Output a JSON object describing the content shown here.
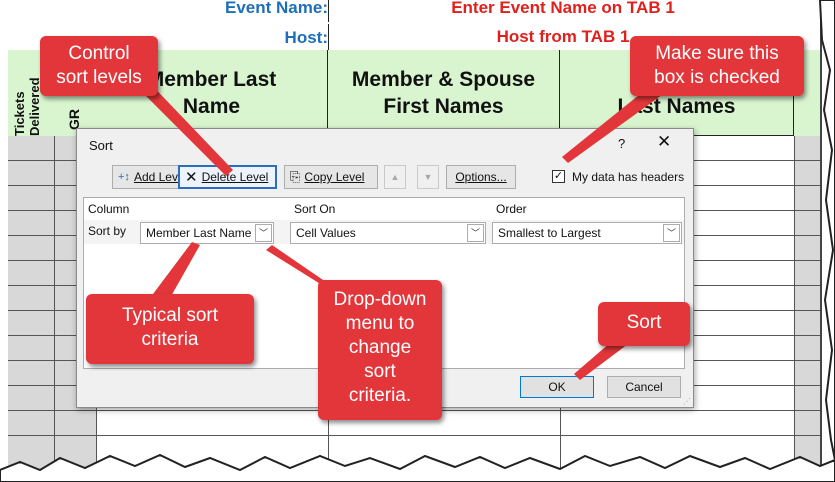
{
  "spreadsheet": {
    "event_label": "Event Name:",
    "event_value": "Enter Event Name on TAB 1",
    "host_label": "Host:",
    "host_value": "Host from TAB 1",
    "col_tickets": "Tickets Delivered",
    "col_gr": "GR",
    "col_member_last": "Member Last Name",
    "col_member_spouse": "Member & Spouse First Names",
    "col_last_names": "Last Names"
  },
  "dialog": {
    "title": "Sort",
    "help": "?",
    "close": "✕",
    "toolbar": {
      "add_level": "Add Level",
      "delete_level": "Delete Level",
      "copy_level": "Copy Level",
      "move_up": "▲",
      "move_down": "▼",
      "options": "Options..."
    },
    "headers_checkbox": {
      "label": "My data has headers",
      "checked": true,
      "mark": "✓"
    },
    "columns": {
      "column": "Column",
      "sort_on": "Sort On",
      "order": "Order"
    },
    "row": {
      "label": "Sort by",
      "column_value": "Member Last Name",
      "sort_on_value": "Cell Values",
      "order_value": "Smallest to Largest"
    },
    "ok": "OK",
    "cancel": "Cancel"
  },
  "callouts": {
    "control": [
      "Control",
      "sort levels"
    ],
    "checkbox": [
      "Make sure this",
      "box is checked"
    ],
    "typical": [
      "Typical sort",
      "criteria"
    ],
    "dropdown": [
      "Drop-down",
      "menu to",
      "change",
      "sort",
      "criteria."
    ],
    "sort": [
      "Sort"
    ]
  },
  "colors": {
    "callout": "#e2363a",
    "header_green": "#d9f5cf",
    "event_blue": "#1f6fb8",
    "event_red": "#e0201c"
  }
}
